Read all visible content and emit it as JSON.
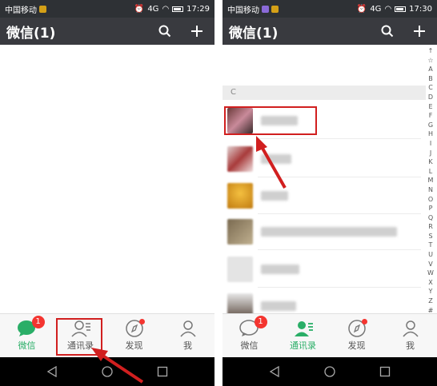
{
  "left_screen": {
    "status": {
      "carrier": "中国移动",
      "time": "17:29",
      "signal": "4G"
    },
    "header": {
      "title": "微信(1)"
    },
    "tabs": [
      {
        "label": "微信",
        "badge": "1",
        "active": true
      },
      {
        "label": "通讯录",
        "active": false
      },
      {
        "label": "发现",
        "dot": true,
        "active": false
      },
      {
        "label": "我",
        "active": false
      }
    ]
  },
  "right_screen": {
    "status": {
      "carrier": "中国移动",
      "time": "17:30",
      "signal": "4G"
    },
    "header": {
      "title": "微信(1)"
    },
    "section_label": "C",
    "index_letters": [
      "↑",
      "☆",
      "A",
      "B",
      "C",
      "D",
      "E",
      "F",
      "G",
      "H",
      "I",
      "J",
      "K",
      "L",
      "M",
      "N",
      "O",
      "P",
      "Q",
      "R",
      "S",
      "T",
      "U",
      "V",
      "W",
      "X",
      "Y",
      "Z",
      "#"
    ],
    "tabs": [
      {
        "label": "微信",
        "badge": "1",
        "active": false
      },
      {
        "label": "通讯录",
        "active": true
      },
      {
        "label": "发现",
        "dot": true,
        "active": false
      },
      {
        "label": "我",
        "active": false
      }
    ]
  },
  "colors": {
    "accent_green": "#2aae67",
    "annotation_red": "#d11f1f",
    "badge_red": "#f43530",
    "appbar": "#393a3f"
  }
}
